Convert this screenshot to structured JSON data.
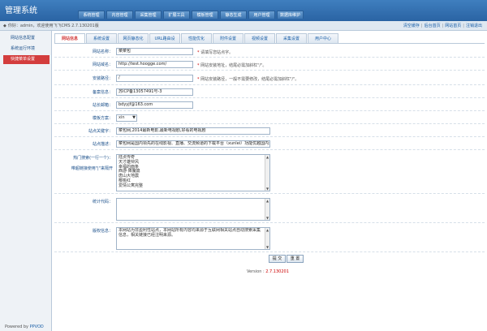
{
  "header": {
    "logo": "管理系统",
    "nav": [
      "系统管理",
      "内容管理",
      "采集管理",
      "扩展工具",
      "模板管理",
      "静态生成",
      "用户管理",
      "数据库维护"
    ]
  },
  "bar": {
    "welcome": "你好：admin，欢迎使用飞飞CMS 2.7.130201版",
    "quick": [
      "清空缓存",
      "后台首页",
      "网站首页",
      "注销退出"
    ]
  },
  "sidebar": {
    "items": [
      {
        "label": "网站信息配置",
        "active": false
      },
      {
        "label": "系统运行环境",
        "active": false
      },
      {
        "label": "快捷菜单设置",
        "active": true
      }
    ],
    "powered_prefix": "Powered by ",
    "powered_brand": "PPVOD"
  },
  "tabs": [
    "网站信息",
    "系统设置",
    "网页静态化",
    "URL路由设",
    "性能优化",
    "附件设置",
    "视频设置",
    "采集设置",
    "用户中心"
  ],
  "form": {
    "site_name": {
      "label": "网站名称：",
      "value": "菜菜包",
      "hint": "请填写您站点字。"
    },
    "site_domain": {
      "label": "网站域名：",
      "value": "http://test.hoogge.com/",
      "hint": "网站安装地址，结尾必需加斜杠\"/\"。"
    },
    "install_path": {
      "label": "安装路径：",
      "value": "/",
      "hint": "网站安装路径，一般不需要修改，结尾必需加斜杠\"/\"。"
    },
    "icp": {
      "label": "备案信息：",
      "value": "苏ICP备13057491号-3"
    },
    "email": {
      "label": "站长邮箱：",
      "value": "bdyyjf@163.com"
    },
    "template": {
      "label": "模板方案：",
      "value": "xin"
    },
    "keywords": {
      "label": "站点关键字：",
      "value": "菜包网,2014最新电影,最新电视剧,好看的电视剧"
    },
    "description": {
      "label": "站点描述：",
      "value": "菜包网是国内领先的在线影视、直播、交流频道的下载平台（xunlei）功能优越国内众多网站的完美体验"
    },
    "hot_search": {
      "label1": "热门搜索(一行一个)：",
      "label2": "带超链接使用\"|\"来隔开",
      "lines": [
        "陆贞传奇",
        "天才雄辩风",
        "幸福的面条",
        "西游·降魔篇",
        "唐山大地震",
        "樱桃红",
        "爱情公寓完整"
      ]
    },
    "stats": {
      "label": "统计代码："
    },
    "copyright": {
      "label": "版权信息：",
      "value": "本网站为非盈利性站点，本网站所有内容均来源于互联网相关站点自动搜索采集信息，相关链接已经注明来源。"
    }
  },
  "actions": {
    "submit": "提 交",
    "reset": "重 置"
  },
  "footer": {
    "version_prefix": "Version : ",
    "version": "2.7.130201"
  }
}
